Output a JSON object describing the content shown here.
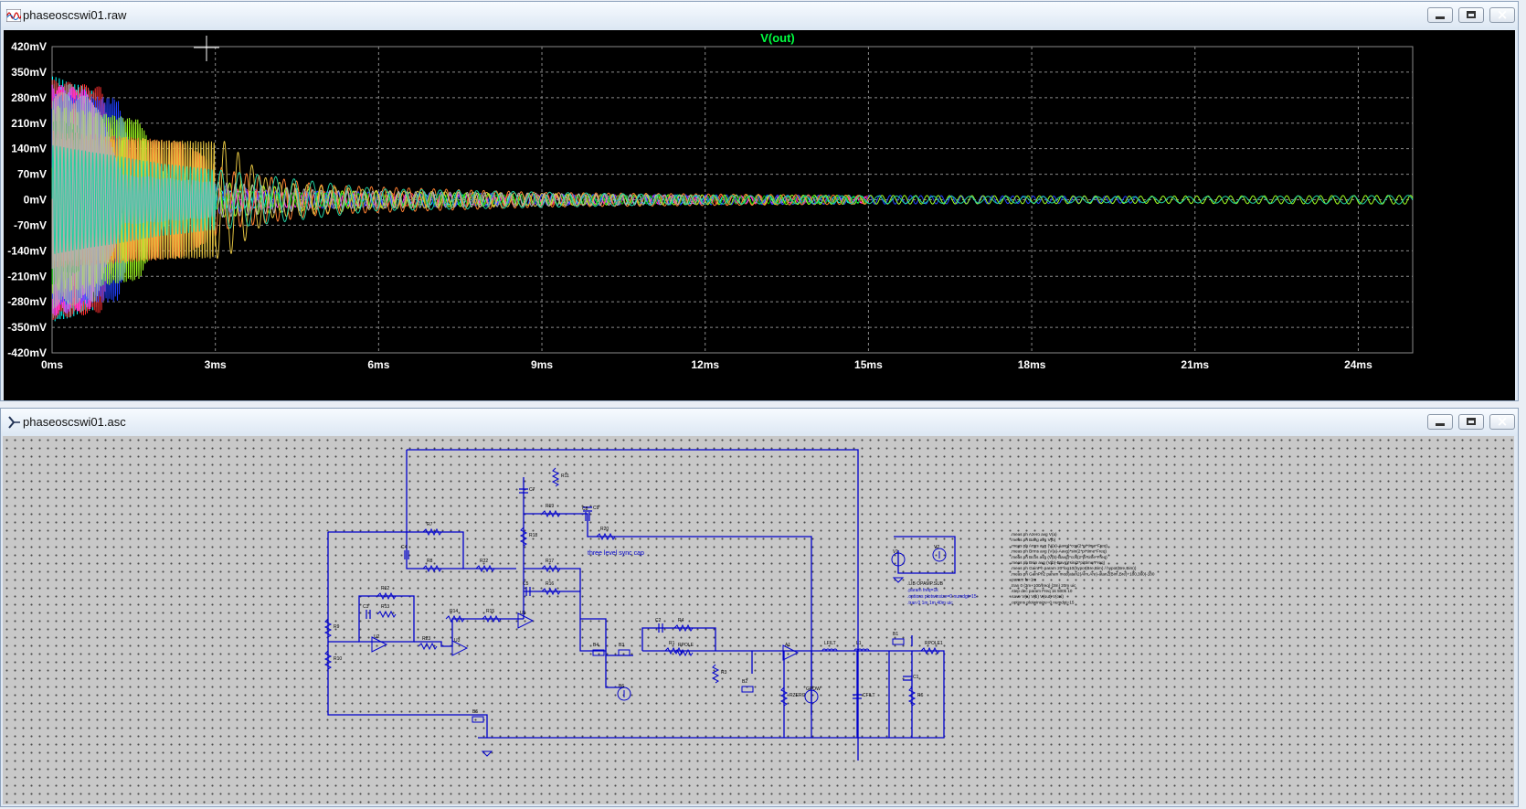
{
  "plot_window": {
    "title": "phaseoscswi01.raw",
    "buttons": {
      "minimize": "minimize",
      "maximize": "maximize",
      "close": "close"
    }
  },
  "schematic_window": {
    "title": "phaseoscswi01.asc",
    "buttons": {
      "minimize": "minimize",
      "maximize": "maximize",
      "close": "close"
    }
  },
  "colors": {
    "plot_background": "#000000",
    "grid": "#8a8a8a",
    "trace_title": "#00ff40",
    "axis_text": "#ffffff",
    "wire": "#0000cc",
    "schematic_background": "#c8c8c8"
  },
  "chart_data": {
    "type": "line",
    "title": "V(out)",
    "xlabel": "",
    "ylabel": "",
    "x_ticks": [
      "0ms",
      "3ms",
      "6ms",
      "9ms",
      "12ms",
      "15ms",
      "18ms",
      "21ms",
      "24ms"
    ],
    "y_ticks": [
      "420mV",
      "350mV",
      "280mV",
      "210mV",
      "140mV",
      "70mV",
      "0mV",
      "-70mV",
      "-140mV",
      "-210mV",
      "-280mV",
      "-350mV",
      "-420mV"
    ],
    "xlim": [
      0,
      25
    ],
    "ylim": [
      -420,
      420
    ],
    "x_unit": "ms",
    "y_unit": "mV",
    "grid": true,
    "series": [
      {
        "color": "#00ffff",
        "amplitude": [
          [
            0,
            340
          ],
          [
            0.8,
            300
          ],
          [
            1.2,
            60
          ],
          [
            3,
            25
          ],
          [
            6,
            15
          ],
          [
            9,
            12
          ],
          [
            12,
            10
          ],
          [
            15,
            8
          ]
        ]
      },
      {
        "color": "#ff3030",
        "amplitude": [
          [
            0,
            330
          ],
          [
            0.9,
            310
          ],
          [
            1.3,
            70
          ],
          [
            3,
            30
          ],
          [
            6,
            18
          ],
          [
            9,
            14
          ],
          [
            12,
            12
          ],
          [
            15,
            10
          ]
        ]
      },
      {
        "color": "#ff30ff",
        "amplitude": [
          [
            0,
            320
          ],
          [
            0.7,
            300
          ],
          [
            1.1,
            55
          ],
          [
            3,
            25
          ],
          [
            6,
            15
          ],
          [
            9,
            12
          ],
          [
            12,
            10
          ],
          [
            15,
            8
          ]
        ]
      },
      {
        "color": "#2040ff",
        "amplitude": [
          [
            0,
            290
          ],
          [
            1.2,
            280
          ],
          [
            1.6,
            60
          ],
          [
            4,
            25
          ],
          [
            9,
            15
          ],
          [
            15,
            12
          ],
          [
            18,
            10
          ],
          [
            20,
            9
          ]
        ]
      },
      {
        "color": "#a0ff20",
        "amplitude": [
          [
            0,
            260
          ],
          [
            1.6,
            220
          ],
          [
            2.1,
            60
          ],
          [
            5,
            25
          ],
          [
            9,
            15
          ],
          [
            15,
            12
          ],
          [
            20,
            10
          ],
          [
            25,
            12
          ]
        ]
      },
      {
        "color": "#00c000",
        "amplitude": [
          [
            0,
            240
          ],
          [
            0.5,
            200
          ],
          [
            0.9,
            40
          ],
          [
            4,
            20
          ],
          [
            9,
            12
          ],
          [
            15,
            10
          ]
        ]
      },
      {
        "color": "#ff8030",
        "amplitude": [
          [
            0,
            190
          ],
          [
            2.4,
            160
          ],
          [
            3.2,
            80
          ],
          [
            5,
            40
          ],
          [
            9,
            20
          ],
          [
            15,
            12
          ]
        ]
      },
      {
        "color": "#e0c040",
        "amplitude": [
          [
            0,
            170
          ],
          [
            3.2,
            160
          ],
          [
            4.0,
            50
          ],
          [
            6,
            25
          ],
          [
            10,
            15
          ]
        ]
      },
      {
        "color": "#b0b0b0",
        "amplitude": [
          [
            0,
            300
          ],
          [
            0.8,
            280
          ],
          [
            1.3,
            70
          ],
          [
            5,
            25
          ],
          [
            12,
            12
          ]
        ]
      },
      {
        "color": "#20d0a0",
        "amplitude": [
          [
            0,
            150
          ],
          [
            2,
            100
          ],
          [
            6,
            30
          ],
          [
            12,
            12
          ],
          [
            20,
            8
          ],
          [
            25,
            12
          ]
        ]
      }
    ]
  },
  "schematic": {
    "annotation": "three level sync cap",
    "components": [
      "R7",
      "C4",
      "R8",
      "R22",
      "R19",
      "C7",
      "R11",
      "C9",
      "C8",
      "R20",
      "R18",
      "R17",
      "C5",
      "R16",
      "R12",
      "C3",
      "R13",
      "R9",
      "R10",
      "U2",
      "R23",
      "R14",
      "U3",
      "R15",
      "U1",
      "R4",
      "C2",
      "R1",
      "B4",
      "B3",
      "RPOLE",
      "R3",
      "B2",
      "RZERO",
      "A1",
      "GPOW",
      "LFILT",
      "L1",
      "B1",
      "C1",
      "R6",
      "RPOLE1",
      "CFILT",
      "V1",
      "V2",
      "B5",
      "B6"
    ],
    "spice_directives": [
      ".meas ph Azero avg V(a)",
      ".meas ph Bavg avg V(b)",
      ".meas ph Arms avg (V(a)-Aavg)*cos(2*pi*time*Freq)",
      ".meas ph Brms avg (V(a)-Aavg)*sin(2*pi*time*Freq)",
      ".meas ph Bcos avg (V(b)-Bavg)*cos(2*pi*time*Freq)",
      ".meas ph Bsin avg (V(b)-Bavg)*sin(2*pi*time*Freq)",
      ".meas ph GainPh param 20*log10(hypot(Bre,Bim) / hypot(Bre,Bim))",
      ".meas ph GainPh2 param mod(atan2(Aim,Are)-atan2(Bim,Bre)+180,360)-180",
      ".param fs=1m",
      ".tran 0 {3m+100/freq} {3m} 20m uic",
      ".step dec param Freq 1k 500k 10",
      ".save V(a) V(b) V(out) V(cal)",
      ".options plotwinsize=0 numdgt=15"
    ],
    "source_labels": [
      ".LIB OPAMP.SUB",
      ".param freq=1k",
      ".options plotwinsize=0 numdgt=15",
      ".tran 0 1m 1m 40m uic"
    ]
  }
}
